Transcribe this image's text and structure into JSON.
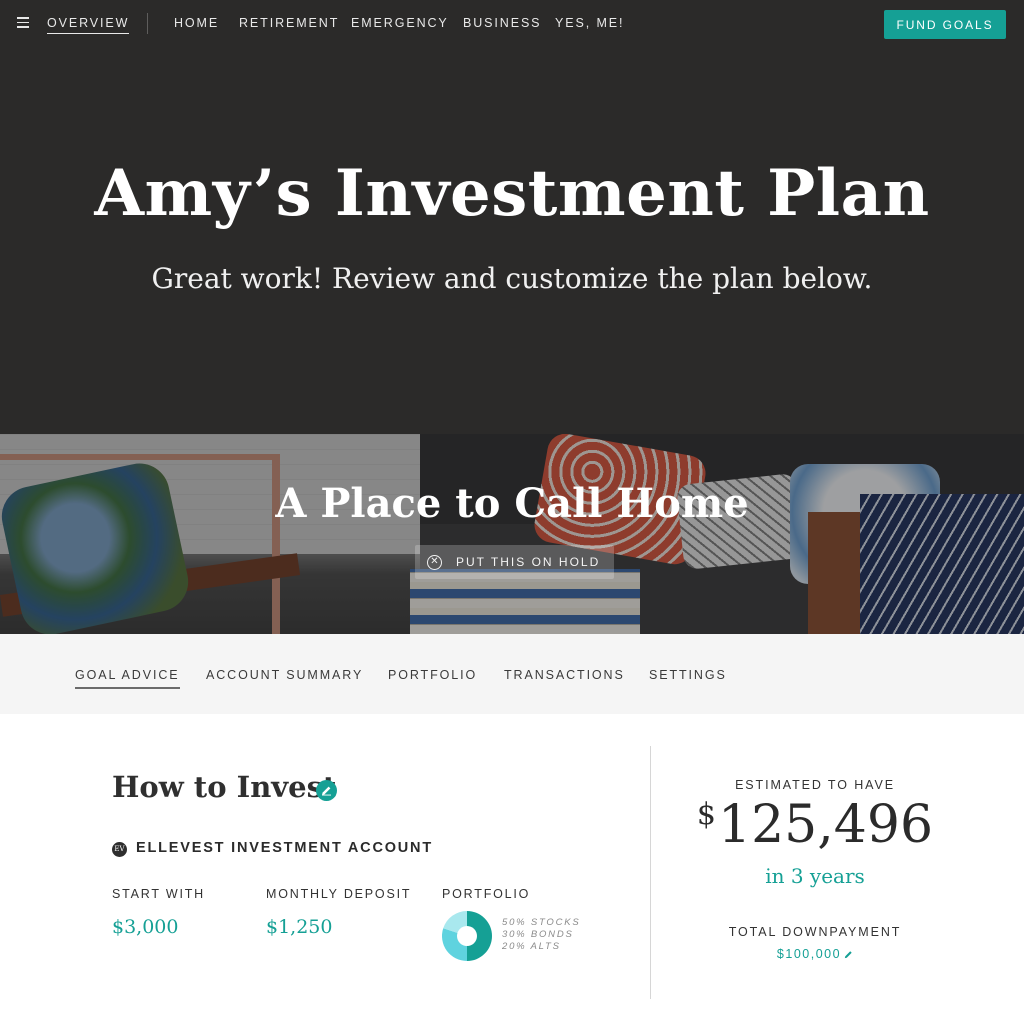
{
  "topnav": {
    "items": [
      {
        "label": "OVERVIEW",
        "active": true
      },
      {
        "label": "HOME"
      },
      {
        "label": "RETIREMENT"
      },
      {
        "label": "EMERGENCY"
      },
      {
        "label": "BUSINESS"
      },
      {
        "label": "YES, ME!"
      }
    ],
    "cta_label": "FUND GOALS",
    "menu_icon": "hamburger-icon"
  },
  "hero": {
    "title": "Amy’s Investment Plan",
    "subtitle": "Great work! Review and customize the plan below."
  },
  "goal": {
    "title": "A Place to Call Home",
    "hold_label": "PUT THIS ON HOLD",
    "hold_icon": "close-circle-icon"
  },
  "subtabs": [
    {
      "label": "GOAL ADVICE",
      "active": true
    },
    {
      "label": "ACCOUNT SUMMARY"
    },
    {
      "label": "PORTFOLIO"
    },
    {
      "label": "TRANSACTIONS"
    },
    {
      "label": "SETTINGS"
    }
  ],
  "invest": {
    "title": "How to Invest",
    "account_logo": "EV",
    "account_name": "ELLEVEST INVESTMENT ACCOUNT",
    "start_label": "START WITH",
    "start_value": "$3,000",
    "monthly_label": "MONTHLY DEPOSIT",
    "monthly_value": "$1,250",
    "portfolio_label": "PORTFOLIO",
    "allocation": [
      {
        "label": "50% STOCKS",
        "percent": 50
      },
      {
        "label": "30% BONDS",
        "percent": 30
      },
      {
        "label": "20% ALTS",
        "percent": 20
      }
    ]
  },
  "estimate": {
    "label": "ESTIMATED TO HAVE",
    "currency": "$",
    "amount": "125,496",
    "timeframe": "in 3 years",
    "downpayment_label": "TOTAL DOWNPAYMENT",
    "downpayment_value": "$100,000"
  },
  "colors": {
    "accent": "#15a095",
    "nav_bg": "#2b2a29",
    "donut_stocks": "#15a095",
    "donut_bonds": "#5fd3df",
    "donut_alts": "#a9e8ee"
  }
}
